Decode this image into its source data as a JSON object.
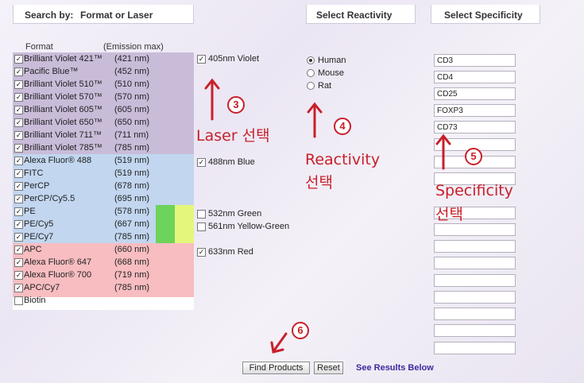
{
  "headers": {
    "search_by": "Search by:",
    "format_or_laser": "Format or Laser",
    "reactivity": "Select Reactivity",
    "specificity": "Select Specificity"
  },
  "format_table": {
    "col_format": "Format",
    "col_emission": "(Emission max)",
    "rows": [
      {
        "name": "Brilliant Violet 421™",
        "emission": "(421 nm)",
        "checked": true,
        "group": "violet"
      },
      {
        "name": "Pacific Blue™",
        "emission": "(452 nm)",
        "checked": true,
        "group": "violet"
      },
      {
        "name": "Brilliant Violet 510™",
        "emission": "(510 nm)",
        "checked": true,
        "group": "violet"
      },
      {
        "name": "Brilliant Violet 570™",
        "emission": "(570 nm)",
        "checked": true,
        "group": "violet"
      },
      {
        "name": "Brilliant Violet 605™",
        "emission": "(605 nm)",
        "checked": true,
        "group": "violet"
      },
      {
        "name": "Brilliant Violet 650™",
        "emission": "(650 nm)",
        "checked": true,
        "group": "violet"
      },
      {
        "name": "Brilliant Violet 711™",
        "emission": "(711 nm)",
        "checked": true,
        "group": "violet"
      },
      {
        "name": "Brilliant Violet 785™",
        "emission": "(785 nm)",
        "checked": true,
        "group": "violet"
      },
      {
        "name": "Alexa Fluor® 488",
        "emission": "(519 nm)",
        "checked": true,
        "group": "blue"
      },
      {
        "name": "FITC",
        "emission": "(519 nm)",
        "checked": true,
        "group": "blue"
      },
      {
        "name": "PerCP",
        "emission": "(678 nm)",
        "checked": true,
        "group": "blue"
      },
      {
        "name": "PerCP/Cy5.5",
        "emission": "(695 nm)",
        "checked": true,
        "group": "blue"
      },
      {
        "name": "PE",
        "emission": "(578 nm)",
        "checked": true,
        "group": "blue"
      },
      {
        "name": "PE/Cy5",
        "emission": "(667 nm)",
        "checked": true,
        "group": "blue"
      },
      {
        "name": "PE/Cy7",
        "emission": "(785 nm)",
        "checked": true,
        "group": "blue"
      },
      {
        "name": "APC",
        "emission": "(660 nm)",
        "checked": true,
        "group": "red"
      },
      {
        "name": "Alexa Fluor® 647",
        "emission": "(668 nm)",
        "checked": true,
        "group": "red"
      },
      {
        "name": "Alexa Fluor® 700",
        "emission": "(719 nm)",
        "checked": true,
        "group": "red"
      },
      {
        "name": "APC/Cy7",
        "emission": "(785 nm)",
        "checked": true,
        "group": "red"
      },
      {
        "name": "Biotin",
        "emission": "",
        "checked": false,
        "group": "none"
      }
    ]
  },
  "lasers": [
    {
      "label": "405nm Violet",
      "checked": true
    },
    {
      "label": "488nm Blue",
      "checked": true
    },
    {
      "label": "532nm Green",
      "checked": false
    },
    {
      "label": "561nm Yellow-Green",
      "checked": false
    },
    {
      "label": "633nm Red",
      "checked": true
    }
  ],
  "reactivity": [
    {
      "label": "Human",
      "selected": true
    },
    {
      "label": "Mouse",
      "selected": false
    },
    {
      "label": "Rat",
      "selected": false
    }
  ],
  "specificity_fields": [
    "CD3",
    "CD4",
    "CD25",
    "FOXP3",
    "CD73",
    "",
    "",
    "",
    "",
    "",
    "",
    "",
    "",
    "",
    "",
    "",
    "",
    ""
  ],
  "annotations": {
    "step3": "3",
    "step4": "4",
    "step5": "5",
    "step6": "6",
    "laser_text": "Laser 선택",
    "reactivity_text_1": "Reactivity",
    "reactivity_text_2": "선택",
    "specificity_text_1": "Specificity",
    "specificity_text_2": "선택"
  },
  "buttons": {
    "find": "Find Products",
    "reset": "Reset",
    "see_results": "See Results Below"
  },
  "colors": {
    "violet": "#c9bcd9",
    "blue": "#c2d6ef",
    "red": "#f7bdc1",
    "pe_green": "#6dd35a",
    "pe_yellow": "#e4f77a",
    "annotation": "#c8202a",
    "link": "#3b2aa0"
  }
}
